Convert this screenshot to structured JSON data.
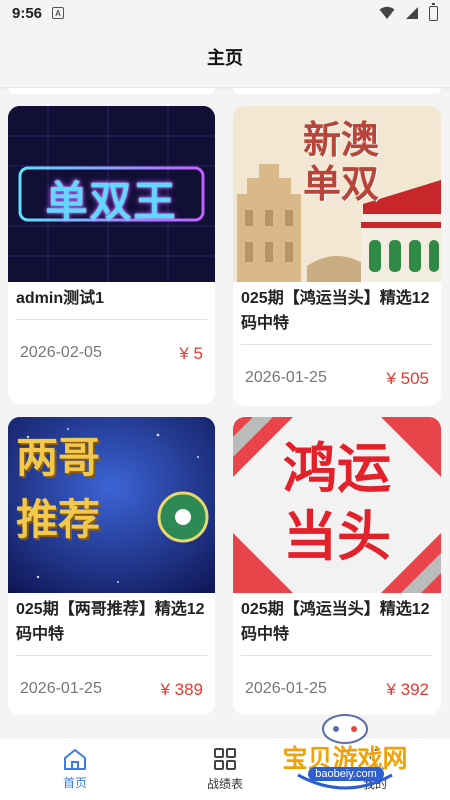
{
  "status": {
    "time": "9:56",
    "notif_letter": "A"
  },
  "header": {
    "title": "主页"
  },
  "cards": [
    {
      "title": "admin测试1",
      "date": "2026-02-05",
      "price": "¥ 5",
      "image_text": "单双王"
    },
    {
      "title": "025期【鸿运当头】精选12码中特",
      "date": "2026-01-25",
      "price": "¥ 505",
      "image_text_1": "新澳",
      "image_text_2": "单双"
    },
    {
      "title": "025期【两哥推荐】精选12码中特",
      "date": "2026-01-25",
      "price": "¥ 389",
      "image_text_1": "两哥",
      "image_text_2": "推荐"
    },
    {
      "title": "025期【鸿运当头】精选12码中特",
      "date": "2026-01-25",
      "price": "¥ 392",
      "image_text_1": "鸿运",
      "image_text_2": "当头"
    }
  ],
  "tabs": [
    {
      "label": "首页",
      "icon": "home-icon",
      "active": true
    },
    {
      "label": "战绩表",
      "icon": "grid-icon",
      "active": false
    },
    {
      "label": "我的",
      "icon": "user-icon",
      "active": false
    }
  ],
  "watermark": {
    "brand": "宝贝游戏网",
    "url": "baobeiy.com"
  },
  "colors": {
    "price": "#e43a2f",
    "active_tab": "#3b7de0"
  }
}
